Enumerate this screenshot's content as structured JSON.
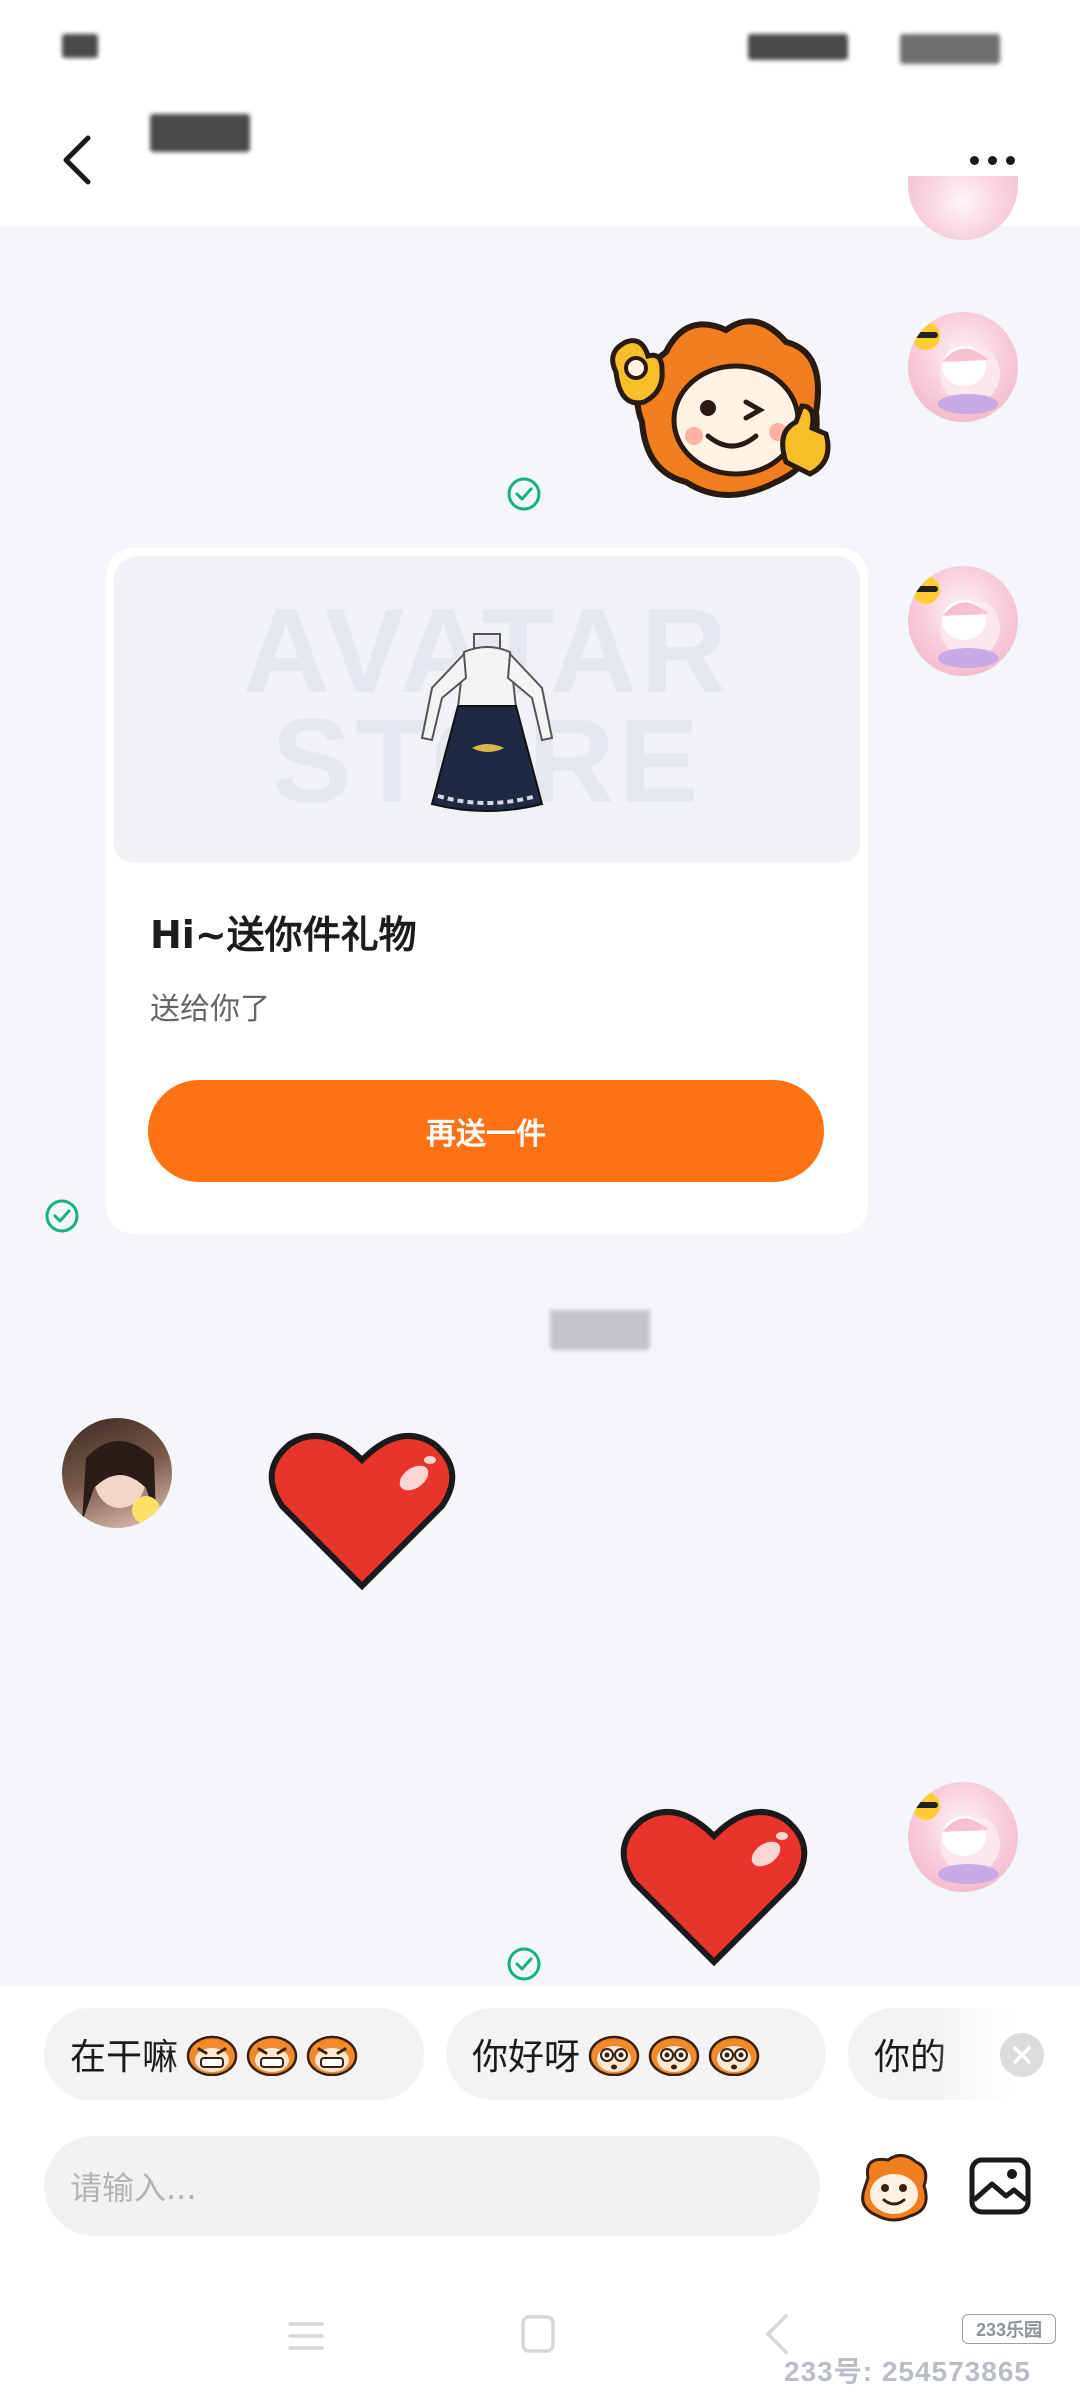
{
  "gift_card": {
    "title": "Hi~送你件礼物",
    "subtitle": "送给你了",
    "button_label": "再送一件",
    "image_watermark": "AVATAR STORE"
  },
  "quick_replies": [
    {
      "label": "在干嘛"
    },
    {
      "label": "你好呀"
    },
    {
      "label": "你的"
    }
  ],
  "input": {
    "placeholder": "请输入..."
  },
  "watermark": {
    "logo": "233乐园",
    "text": "233号: 254573865"
  },
  "colors": {
    "accent": "#ff7214",
    "check": "#14b37d",
    "background": "#f4f6fa"
  },
  "icons": [
    "back-icon",
    "more-icon",
    "sent-check-icon",
    "emoji-icon",
    "image-icon",
    "close-icon",
    "nav-menu-icon",
    "nav-home-icon",
    "nav-back-icon"
  ]
}
